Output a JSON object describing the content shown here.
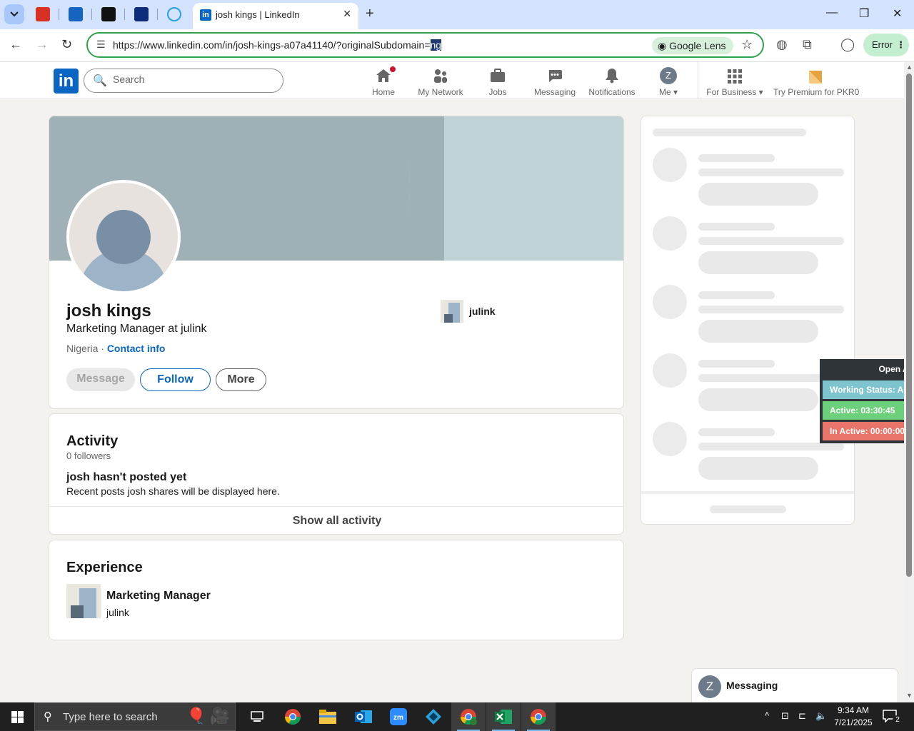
{
  "browser": {
    "tab_title": "josh kings | LinkedIn",
    "url": "https://www.linkedin.com/in/josh-kings-a07a41140/?originalSubdomain=",
    "url_selected": "ng",
    "lens_label": "Google Lens",
    "error_label": "Error"
  },
  "linkedin": {
    "search_placeholder": "Search",
    "nav": {
      "home": "Home",
      "network": "My Network",
      "jobs": "Jobs",
      "messaging": "Messaging",
      "notifications": "Notifications",
      "me": "Me",
      "me_initial": "Z",
      "business": "For Business",
      "premium": "Try Premium for PKR0"
    }
  },
  "profile": {
    "name": "josh kings",
    "headline": "Marketing Manager at julink",
    "location": "Nigeria",
    "location_sep": " · ",
    "contact_info": "Contact info",
    "company": "julink",
    "buttons": {
      "message": "Message",
      "follow": "Follow",
      "more": "More"
    }
  },
  "activity": {
    "title": "Activity",
    "followers": "0 followers",
    "empty_title": "josh hasn't posted yet",
    "empty_body": "Recent posts josh shares will be displayed here.",
    "show_all": "Show all activity"
  },
  "experience": {
    "title": "Experience",
    "items": [
      {
        "role": "Marketing Manager",
        "company": "julink"
      }
    ]
  },
  "widget": {
    "header": "Open Ap",
    "status": "Working Status: Activ",
    "active": "Active: 03:30:45",
    "inactive": "In Active: 00:00:00",
    "colors": {
      "status": "#7ec4cf",
      "active": "#6ccf79",
      "inactive": "#e8746a"
    }
  },
  "messaging": {
    "label": "Messaging",
    "initial": "Z"
  },
  "taskbar": {
    "search_placeholder": "Type here to search",
    "time": "9:34 AM",
    "date": "7/21/2025",
    "notification_count": "2"
  },
  "colors": {
    "linkedin_blue": "#0a66c2",
    "badge_red": "#cb112d",
    "omnibox_green": "#30a14e"
  }
}
